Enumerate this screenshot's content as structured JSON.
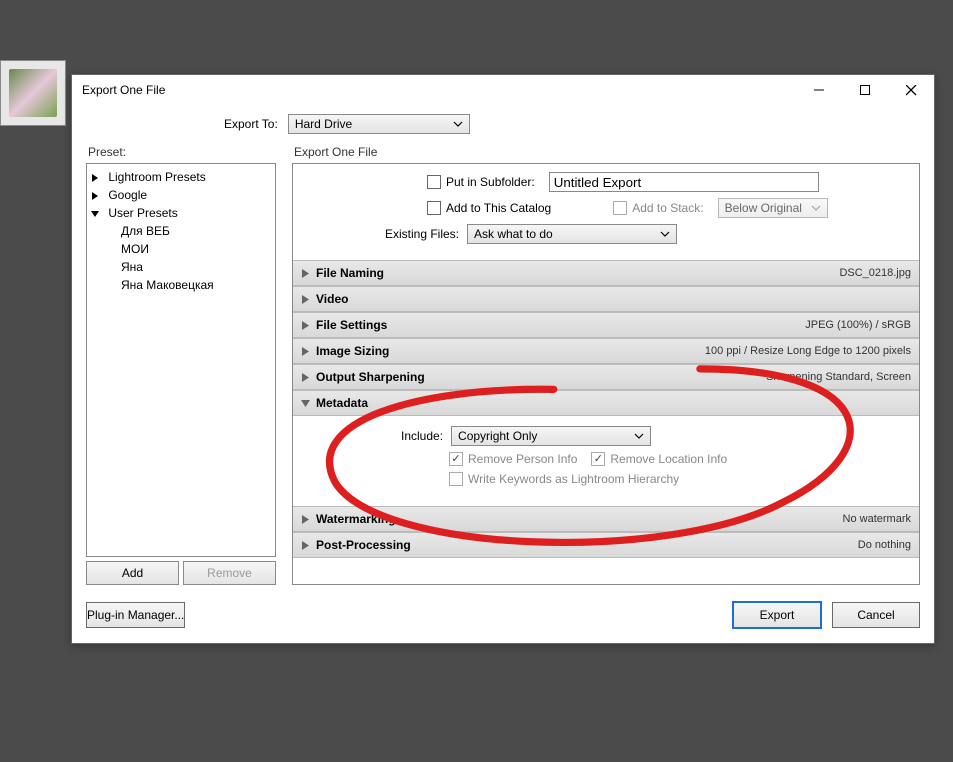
{
  "window": {
    "title": "Export One File"
  },
  "exportTo": {
    "label": "Export To:",
    "value": "Hard Drive"
  },
  "presetPanel": {
    "label": "Preset:",
    "items": [
      {
        "label": "Lightroom Presets",
        "expanded": false,
        "level": 0
      },
      {
        "label": "Google",
        "expanded": false,
        "level": 0
      },
      {
        "label": "User Presets",
        "expanded": true,
        "level": 0
      },
      {
        "label": "Для ВЕБ",
        "level": 1
      },
      {
        "label": "МОИ",
        "level": 1
      },
      {
        "label": "Яна",
        "level": 1
      },
      {
        "label": "Яна Маковецкая",
        "level": 1
      }
    ],
    "addLabel": "Add",
    "removeLabel": "Remove"
  },
  "mainPanel": {
    "label": "Export One File",
    "topArea": {
      "putInSubfolder": {
        "label": "Put in Subfolder:",
        "checked": false
      },
      "subfolderValue": "Untitled Export",
      "addToCatalog": {
        "label": "Add to This Catalog",
        "checked": false
      },
      "addToStack": {
        "label": "Add to Stack:",
        "checked": false
      },
      "stackPosition": "Below Original",
      "existingFilesLabel": "Existing Files:",
      "existingFilesValue": "Ask what to do"
    },
    "sections": [
      {
        "id": "fileNaming",
        "label": "File Naming",
        "summary": "DSC_0218.jpg",
        "open": false
      },
      {
        "id": "video",
        "label": "Video",
        "summary": "",
        "open": false
      },
      {
        "id": "fileSettings",
        "label": "File Settings",
        "summary": "JPEG (100%) / sRGB",
        "open": false
      },
      {
        "id": "imageSizing",
        "label": "Image Sizing",
        "summary": "100 ppi / Resize Long Edge to 1200 pixels",
        "open": false
      },
      {
        "id": "outputSharpening",
        "label": "Output Sharpening",
        "summary": "Sharpening Standard, Screen",
        "open": false
      },
      {
        "id": "metadata",
        "label": "Metadata",
        "summary": "",
        "open": true,
        "body": {
          "includeLabel": "Include:",
          "includeValue": "Copyright Only",
          "removePerson": {
            "label": "Remove Person Info",
            "checked": true
          },
          "removeLocation": {
            "label": "Remove Location Info",
            "checked": true
          },
          "writeKeywords": {
            "label": "Write Keywords as Lightroom Hierarchy",
            "checked": false
          }
        }
      },
      {
        "id": "watermarking",
        "label": "Watermarking",
        "summary": "No watermark",
        "open": false
      },
      {
        "id": "postProcessing",
        "label": "Post-Processing",
        "summary": "Do nothing",
        "open": false
      }
    ]
  },
  "footer": {
    "pluginManager": "Plug-in Manager...",
    "export": "Export",
    "cancel": "Cancel"
  }
}
